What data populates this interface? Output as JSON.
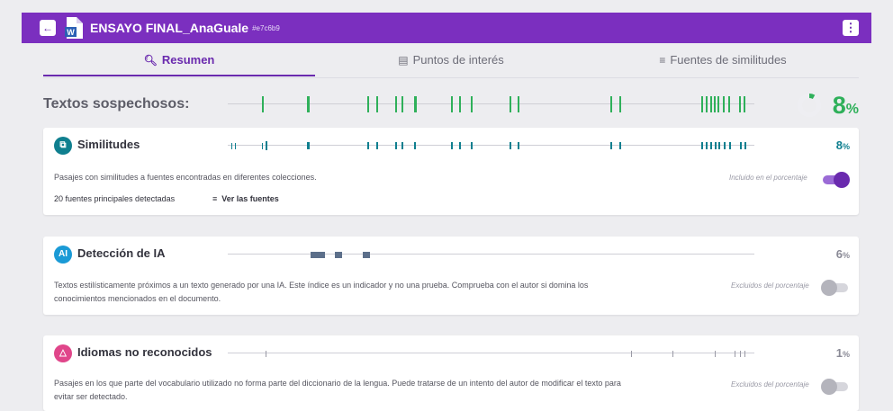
{
  "header": {
    "back_icon": "arrow-left-icon",
    "doc_icon": "word-document-icon",
    "title": "ENSAYO FINAL_AnaGuale",
    "doc_id": "#e7c6b9",
    "menu_icon": "kebab-menu-icon"
  },
  "tabs": [
    {
      "label": "Resumen",
      "icon": "search-icon",
      "active": true
    },
    {
      "label": "Puntos de interés",
      "icon": "document-list-icon",
      "active": false
    },
    {
      "label": "Fuentes de similitudes",
      "icon": "list-icon",
      "active": false
    }
  ],
  "suspicious": {
    "title": "Textos sospechosos:",
    "percent": "8",
    "percent_sign": "%",
    "percent_value": 8,
    "color": "#2fb05a"
  },
  "cards": {
    "similitudes": {
      "title": "Similitudes",
      "percent": "8",
      "percent_sign": "%",
      "description": "Pasajes con similitudes a fuentes encontradas en diferentes colecciones.",
      "toggle_label": "Incluido en el porcentaje",
      "toggle_on": true,
      "sources_count": "20 fuentes principales detectadas",
      "sources_link": "Ver las fuentes",
      "color": "#0f7f8f"
    },
    "ia": {
      "title": "Detección de IA",
      "percent": "6",
      "percent_sign": "%",
      "description_line1": "Textos estilísticamente próximos a un texto generado por una IA. Este índice es un indicador y no una prueba. Comprueba con el autor si domina los",
      "description_line2": "conocimientos mencionados en el documento.",
      "toggle_label": "Excluidos del porcentaje",
      "toggle_on": false,
      "color": "#1a9ad6"
    },
    "idiomas": {
      "title": "Idiomas no reconocidos",
      "percent": "1",
      "percent_sign": "%",
      "description_line1": "Pasajes en los que parte del vocabulario utilizado no forma parte del diccionario de la lengua. Puede tratarse de un intento del autor de modificar el texto para",
      "description_line2": "evitar ser detectado.",
      "toggle_label": "Excluidos del porcentaje",
      "toggle_on": false,
      "color": "#e0468a"
    }
  },
  "colors": {
    "brand": "#7b2fbf",
    "accent": "#6a2aae",
    "similarity": "#0f7f8f",
    "suspicious": "#2fb05a",
    "ai": "#5c6f8a",
    "language": "#9a9aa6"
  }
}
